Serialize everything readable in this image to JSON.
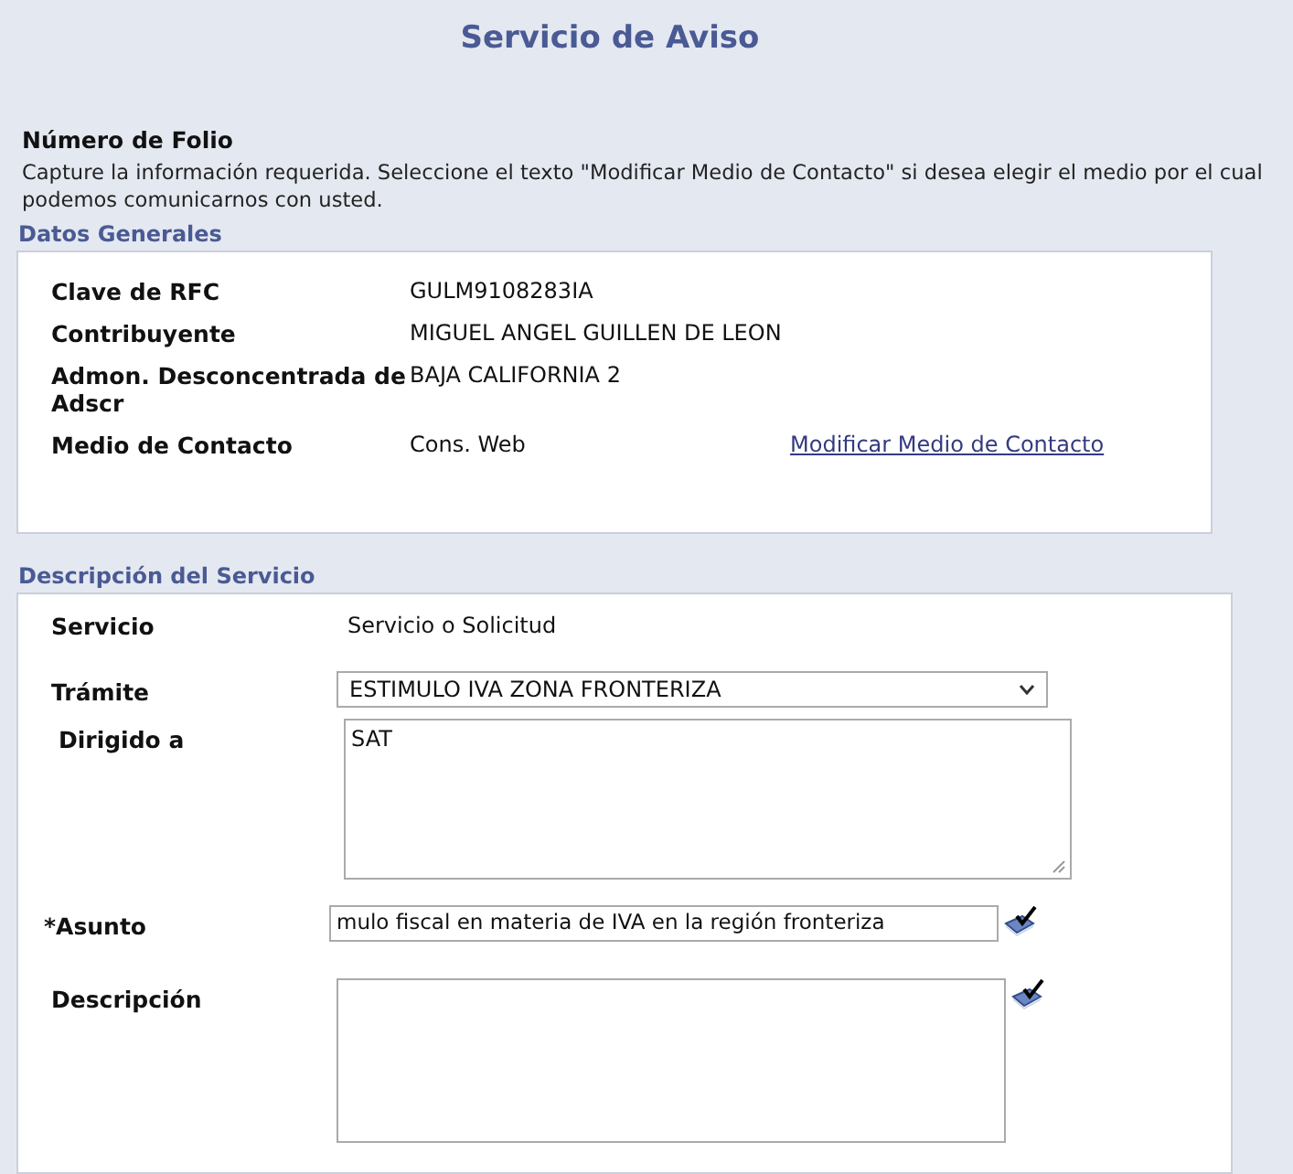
{
  "title": "Servicio de Aviso",
  "folio_label": "Número de Folio",
  "instructions": "Capture la información requerida. Seleccione el texto \"Modificar Medio de Contacto\" si desea elegir el medio por el cual podemos comunicarnos con usted.",
  "datos_generales": {
    "heading": "Datos Generales",
    "fields": [
      {
        "label": "Clave de RFC",
        "value": "GULM9108283IA"
      },
      {
        "label": "Contribuyente",
        "value": "MIGUEL ANGEL GUILLEN DE LEON"
      },
      {
        "label": "Admon. Desconcentrada de Adscr",
        "value": "BAJA CALIFORNIA 2"
      },
      {
        "label": "Medio de Contacto",
        "value": "Cons. Web",
        "link": "Modificar Medio de Contacto"
      }
    ]
  },
  "descripcion_servicio": {
    "heading": "Descripción del Servicio",
    "fields": [
      {
        "kind": "text",
        "label": "Servicio",
        "value": "Servicio o Solicitud"
      },
      {
        "kind": "select",
        "label": "Trámite",
        "value": "ESTIMULO IVA ZONA FRONTERIZA"
      },
      {
        "kind": "textarea",
        "label": "Dirigido a",
        "value": "SAT"
      },
      {
        "kind": "input",
        "label": "*Asunto",
        "value": "mulo fiscal en materia de IVA en la región fronteriza"
      },
      {
        "kind": "textarea_check",
        "label": "Descripción"
      }
    ]
  }
}
